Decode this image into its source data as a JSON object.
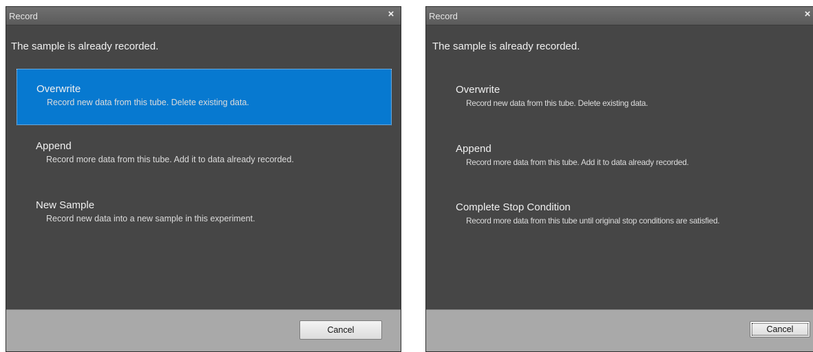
{
  "dialogs": [
    {
      "title": "Record",
      "close_glyph": "×",
      "message": "The sample is already recorded.",
      "options": [
        {
          "title": "Overwrite",
          "description": "Record new data from this tube. Delete existing data.",
          "selected": true
        },
        {
          "title": "Append",
          "description": "Record more data from this tube. Add it to data already recorded.",
          "selected": false
        },
        {
          "title": "New Sample",
          "description": "Record new data into a new sample in this experiment.",
          "selected": false
        }
      ],
      "cancel_label": "Cancel"
    },
    {
      "title": "Record",
      "close_glyph": "×",
      "message": "The sample is already recorded.",
      "options": [
        {
          "title": "Overwrite",
          "description": "Record new data from this tube. Delete existing data.",
          "selected": false
        },
        {
          "title": "Append",
          "description": "Record more data from this tube. Add it to data already recorded.",
          "selected": false
        },
        {
          "title": "Complete Stop Condition",
          "description": "Record more data from this tube until original stop conditions are satisfied.",
          "selected": false
        }
      ],
      "cancel_label": "Cancel"
    }
  ],
  "colors": {
    "dialog_bg": "#464646",
    "selected_option": "#0779d0",
    "footer_bg": "#a9a9a9"
  },
  "icons": {
    "close": "close-icon"
  }
}
